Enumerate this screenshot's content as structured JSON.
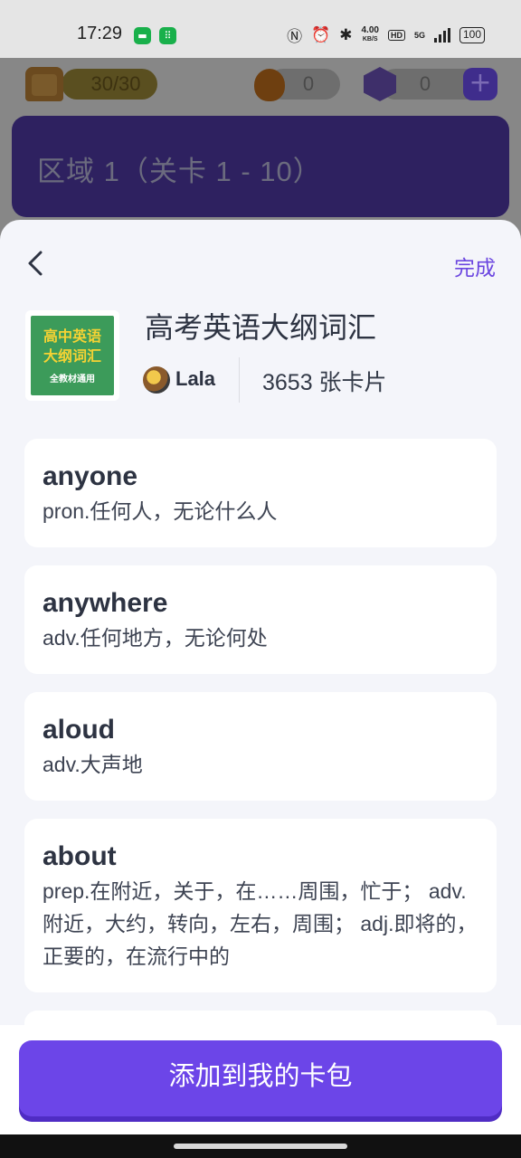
{
  "status_bar": {
    "time": "17:29",
    "speed_value": "4.00",
    "speed_unit": "KB/S",
    "hd_label": "HD",
    "network_label": "5G",
    "battery": "100"
  },
  "game_header": {
    "bread_count": "30/30",
    "fire_count": "0",
    "gem_count": "0",
    "plus_label": "+",
    "region_title": "区域 1（关卡 1 - 10）"
  },
  "sheet": {
    "done_label": "完成",
    "deck": {
      "cover_line1": "高中英语",
      "cover_line2": "大纲词汇",
      "cover_sub": "全教材通用",
      "title": "高考英语大纲词汇",
      "author": "Lala",
      "card_count": "3653 张卡片"
    },
    "cards": [
      {
        "word": "anyone",
        "meaning": "pron.任何人，无论什么人"
      },
      {
        "word": "anywhere",
        "meaning": "adv.任何地方，无论何处"
      },
      {
        "word": "aloud",
        "meaning": "adv.大声地"
      },
      {
        "word": "about",
        "meaning": "prep.在附近，关于，在……周围，忙于； adv.附近，大约，转向，左右，周围； adj.即将的，正要的，在流行中的"
      }
    ],
    "add_button_label": "添加到我的卡包"
  },
  "colors": {
    "accent": "#6c45e8",
    "done_text": "#6b46e0",
    "sheet_bg": "#f4f5fa"
  }
}
